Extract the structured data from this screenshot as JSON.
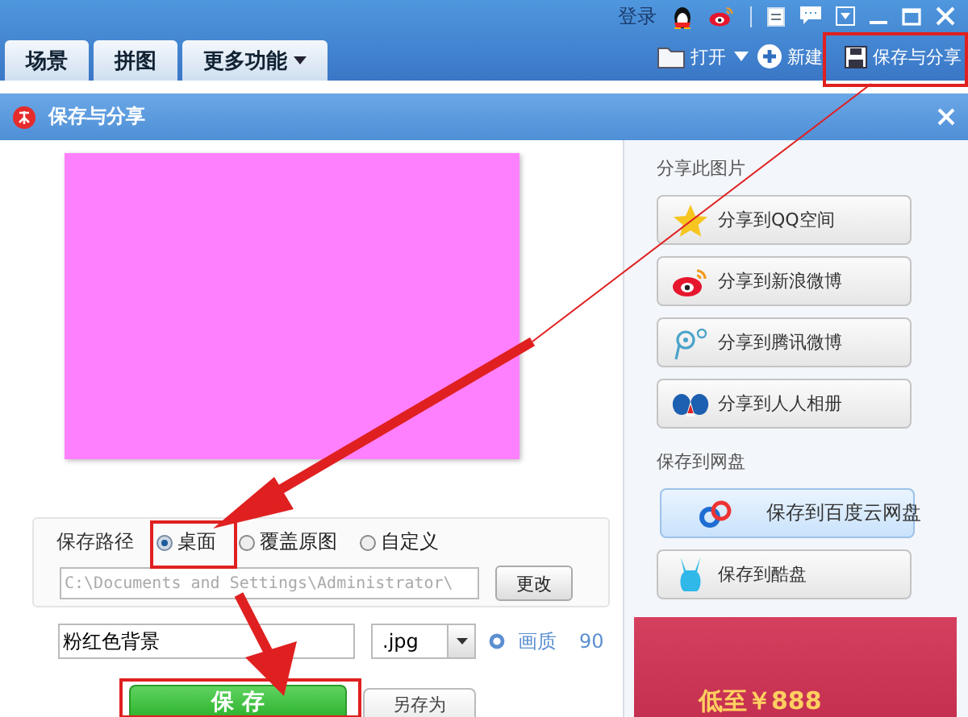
{
  "topbar": {
    "login": "登录",
    "tabs": [
      {
        "label": "场景",
        "selected": false,
        "kind": "tab"
      },
      {
        "label": "拼图",
        "selected": false,
        "kind": "tab"
      },
      {
        "label": "更多功能",
        "selected": false,
        "kind": "menu"
      }
    ],
    "toolbar": [
      {
        "label": "打开",
        "kind": "open"
      },
      {
        "label": "新建",
        "kind": "new"
      },
      {
        "label": "保存与分享",
        "kind": "save"
      }
    ]
  },
  "dialog": {
    "title": "保存与分享",
    "save_path": {
      "label": "保存路径",
      "options": [
        {
          "label": "桌面",
          "selected": true
        },
        {
          "label": "覆盖原图",
          "selected": false
        },
        {
          "label": "自定义",
          "selected": false
        }
      ],
      "path": "C:\\Documents and Settings\\Administrator\\",
      "change_button": "更改"
    },
    "file_name": "粉红色背景",
    "format": ".jpg",
    "quality_label": "画质",
    "quality_value": "90",
    "save_button": "保 存",
    "save_as_button": "另存为",
    "share": {
      "heading": "分享此图片",
      "buttons": [
        {
          "label": "分享到QQ空间",
          "kind": "star",
          "selected": false
        },
        {
          "label": "分享到新浪微博",
          "kind": "weibo",
          "selected": false
        },
        {
          "label": "分享到腾讯微博",
          "kind": "tweibo",
          "selected": false
        },
        {
          "label": "分享到人人相册",
          "kind": "renren",
          "selected": false
        }
      ]
    },
    "cloud": {
      "heading": "保存到网盘",
      "buttons": [
        {
          "label": "保存到百度云网盘",
          "kind": "baidu",
          "selected": true
        },
        {
          "label": "保存到酷盘",
          "kind": "rabbit",
          "selected": false
        }
      ]
    },
    "ad": {
      "text": "低至￥888"
    }
  }
}
